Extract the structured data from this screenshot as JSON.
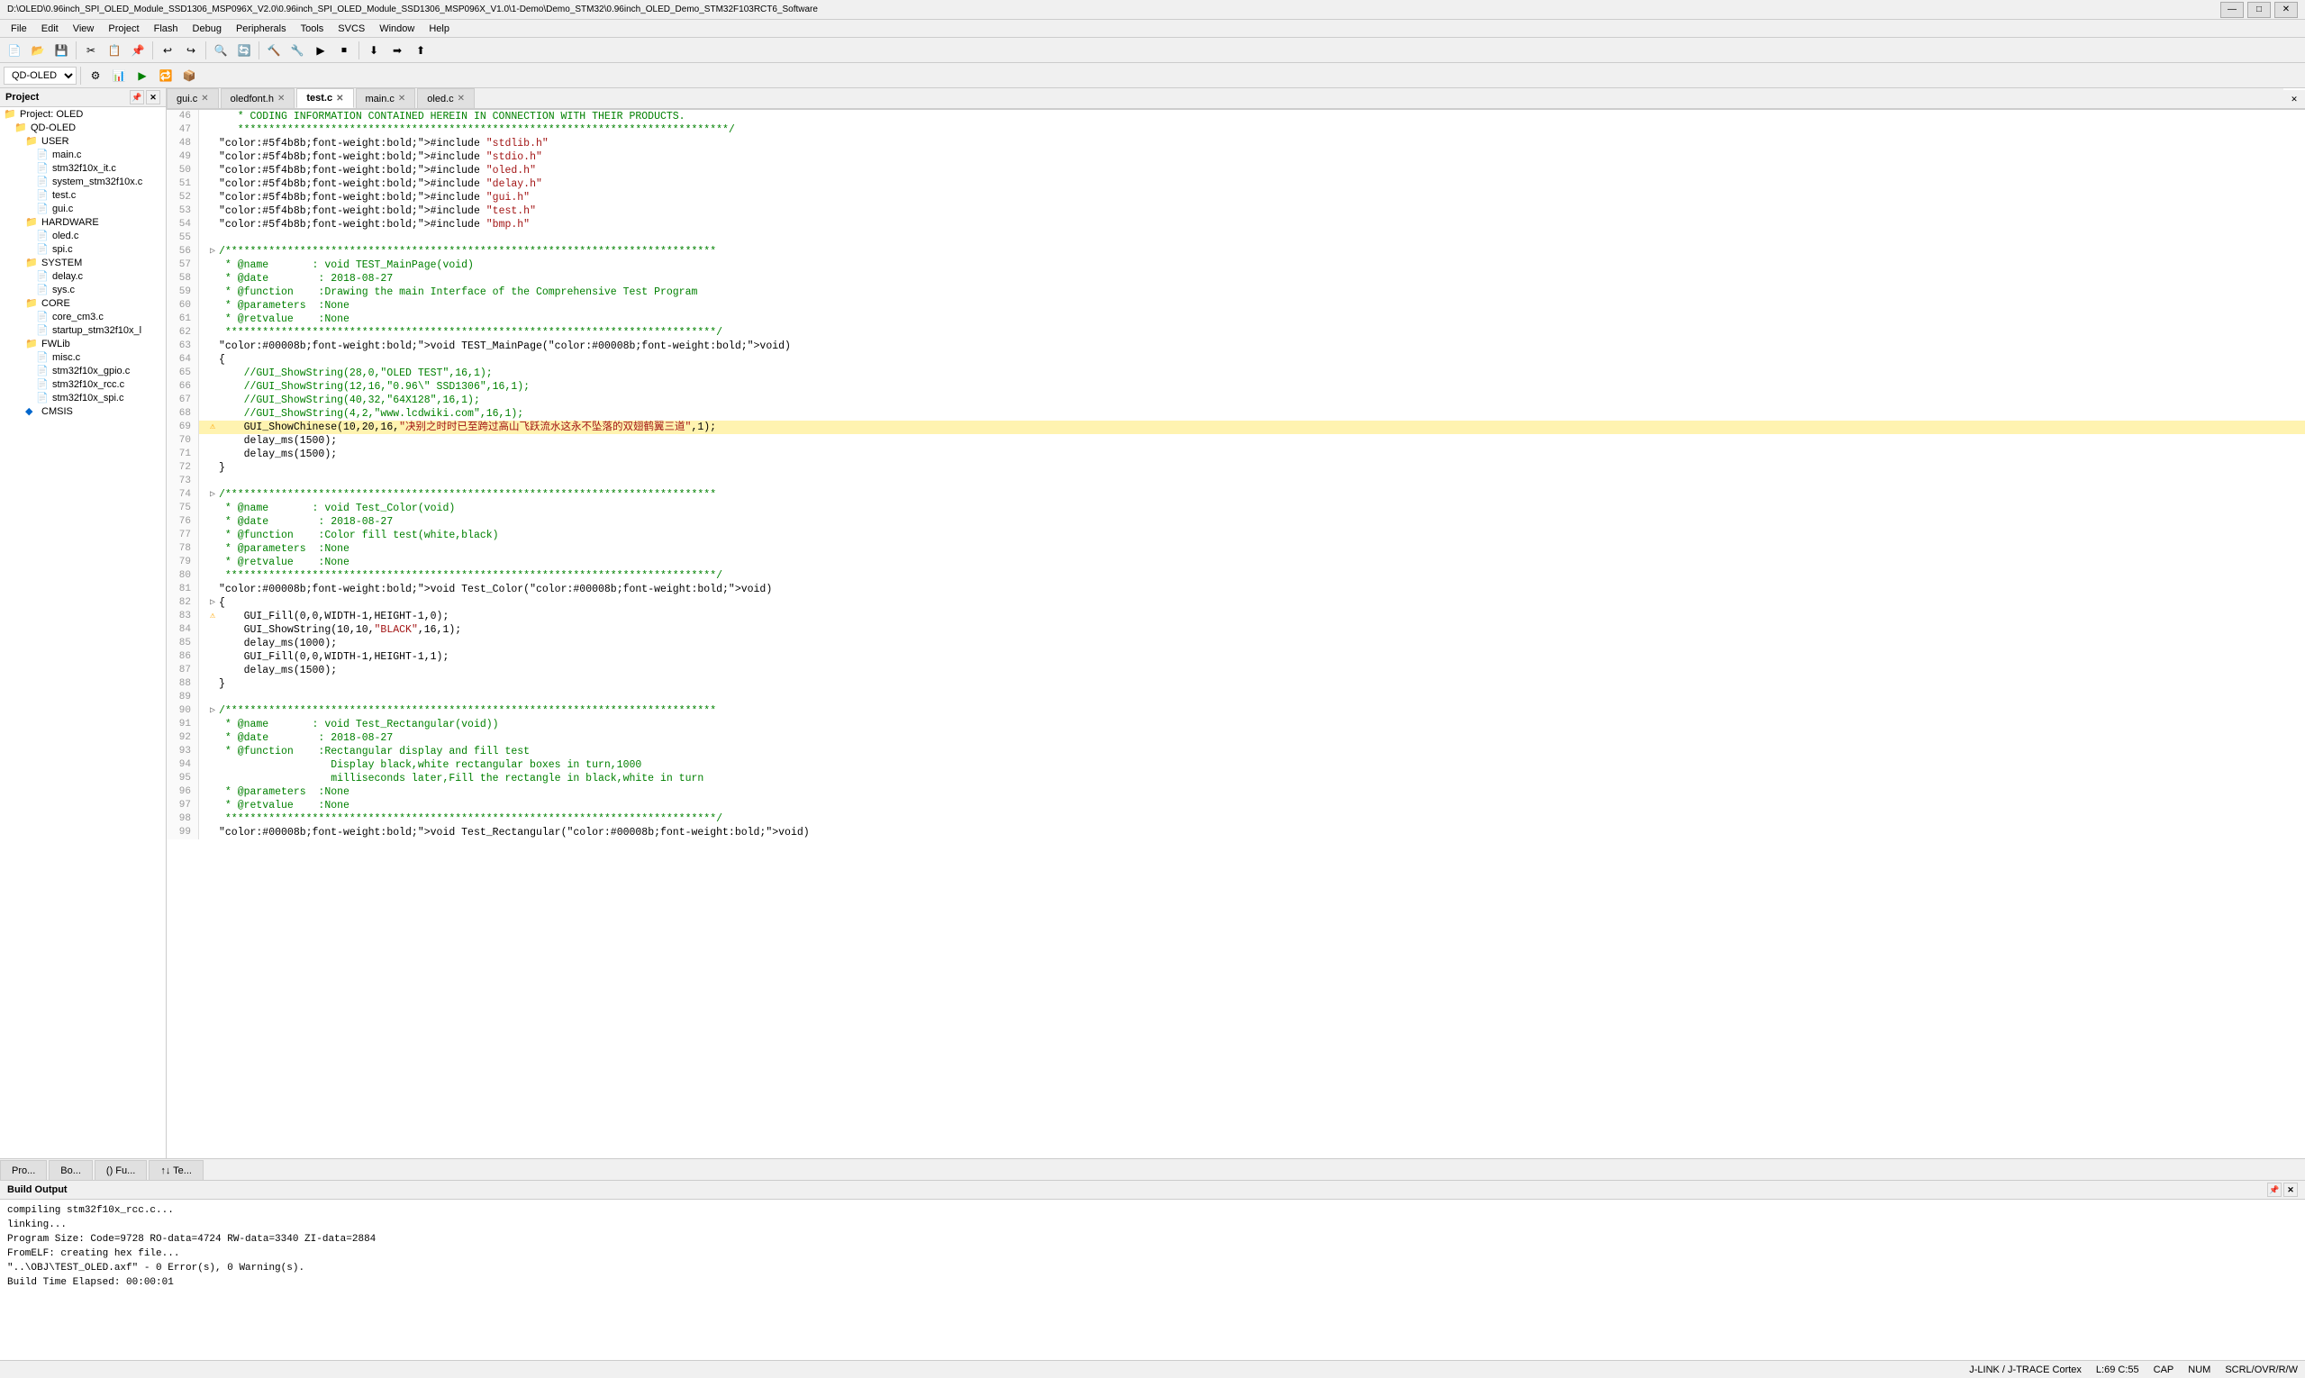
{
  "titleBar": {
    "text": "D:\\OLED\\0.96inch_SPI_OLED_Module_SSD1306_MSP096X_V2.0\\0.96inch_SPI_OLED_Module_SSD1306_MSP096X_V1.0\\1-Demo\\Demo_STM32\\0.96inch_OLED_Demo_STM32F103RCT6_Software",
    "minBtn": "—",
    "maxBtn": "□",
    "closeBtn": "✕"
  },
  "menuBar": {
    "items": [
      "File",
      "Edit",
      "View",
      "Project",
      "Flash",
      "Debug",
      "Peripherals",
      "Tools",
      "SVCS",
      "Window",
      "Help"
    ]
  },
  "toolbar1": {
    "buttons": [
      "📂",
      "💾",
      "✕",
      "📋",
      "📋",
      "↩",
      "↪",
      "🔍",
      "🔍",
      "🔧",
      "🔧",
      "🔧",
      "🔧",
      "🔧"
    ]
  },
  "toolbar2": {
    "select": "QD-OLED",
    "buttons": []
  },
  "sidebar": {
    "title": "Project",
    "projectRoot": "Project: OLED",
    "tree": [
      {
        "id": "oled",
        "label": "Project: OLED",
        "level": 0,
        "icon": "📁",
        "expanded": true
      },
      {
        "id": "qd-oled",
        "label": "QD-OLED",
        "level": 1,
        "icon": "📁",
        "expanded": true
      },
      {
        "id": "user",
        "label": "USER",
        "level": 2,
        "icon": "📁",
        "expanded": true
      },
      {
        "id": "main-c",
        "label": "main.c",
        "level": 3,
        "icon": "📄"
      },
      {
        "id": "stm32f10x_it",
        "label": "stm32f10x_it.c",
        "level": 3,
        "icon": "📄"
      },
      {
        "id": "system_stm32f10x",
        "label": "system_stm32f10x.c",
        "level": 3,
        "icon": "📄"
      },
      {
        "id": "test-c",
        "label": "test.c",
        "level": 3,
        "icon": "📄"
      },
      {
        "id": "gui-c",
        "label": "gui.c",
        "level": 3,
        "icon": "📄"
      },
      {
        "id": "hardware",
        "label": "HARDWARE",
        "level": 2,
        "icon": "📁",
        "expanded": true
      },
      {
        "id": "oled-c",
        "label": "oled.c",
        "level": 3,
        "icon": "📄"
      },
      {
        "id": "spi-c",
        "label": "spi.c",
        "level": 3,
        "icon": "📄"
      },
      {
        "id": "system",
        "label": "SYSTEM",
        "level": 2,
        "icon": "📁",
        "expanded": true
      },
      {
        "id": "delay-c",
        "label": "delay.c",
        "level": 3,
        "icon": "📄"
      },
      {
        "id": "sys-c",
        "label": "sys.c",
        "level": 3,
        "icon": "📄"
      },
      {
        "id": "core",
        "label": "CORE",
        "level": 2,
        "icon": "📁",
        "expanded": true
      },
      {
        "id": "core-cm3",
        "label": "core_cm3.c",
        "level": 3,
        "icon": "📄"
      },
      {
        "id": "startup",
        "label": "startup_stm32f10x_l",
        "level": 3,
        "icon": "📄"
      },
      {
        "id": "fwlib",
        "label": "FWLib",
        "level": 2,
        "icon": "📁",
        "expanded": true
      },
      {
        "id": "misc",
        "label": "misc.c",
        "level": 3,
        "icon": "📄"
      },
      {
        "id": "stm32f10x-gpio",
        "label": "stm32f10x_gpio.c",
        "level": 3,
        "icon": "📄"
      },
      {
        "id": "stm32f10x-rcc",
        "label": "stm32f10x_rcc.c",
        "level": 3,
        "icon": "📄"
      },
      {
        "id": "stm32f10x-spi",
        "label": "stm32f10x_spi.c",
        "level": 3,
        "icon": "📄"
      },
      {
        "id": "cmsis",
        "label": "CMSIS",
        "level": 2,
        "icon": "💠"
      }
    ]
  },
  "tabs": [
    {
      "id": "gui-c",
      "label": "gui.c",
      "active": false,
      "icon": "📄"
    },
    {
      "id": "oledfont-h",
      "label": "oledfont.h",
      "active": false,
      "icon": "📄"
    },
    {
      "id": "test-c",
      "label": "test.c",
      "active": true,
      "icon": "📄"
    },
    {
      "id": "main-c",
      "label": "main.c",
      "active": false,
      "icon": "📄"
    },
    {
      "id": "oled-c",
      "label": "oled.c",
      "active": false,
      "icon": "📄"
    }
  ],
  "codeLines": [
    {
      "num": 46,
      "content": "   * CODING INFORMATION CONTAINED HEREIN IN CONNECTION WITH THEIR PRODUCTS.",
      "type": "comment"
    },
    {
      "num": 47,
      "content": "   *******************************************************************************/",
      "type": "comment"
    },
    {
      "num": 48,
      "content": "#include \"stdlib.h\"",
      "type": "include"
    },
    {
      "num": 49,
      "content": "#include \"stdio.h\"",
      "type": "include"
    },
    {
      "num": 50,
      "content": "#include \"oled.h\"",
      "type": "include"
    },
    {
      "num": 51,
      "content": "#include \"delay.h\"",
      "type": "include"
    },
    {
      "num": 52,
      "content": "#include \"gui.h\"",
      "type": "include"
    },
    {
      "num": 53,
      "content": "#include \"test.h\"",
      "type": "include"
    },
    {
      "num": 54,
      "content": "#include \"bmp.h\"",
      "type": "include"
    },
    {
      "num": 55,
      "content": "",
      "type": "blank"
    },
    {
      "num": 56,
      "content": "/*******************************************************************************",
      "type": "comment",
      "indicator": "▷"
    },
    {
      "num": 57,
      "content": " * @name       : void TEST_MainPage(void)",
      "type": "comment"
    },
    {
      "num": 58,
      "content": " * @date        : 2018-08-27",
      "type": "comment"
    },
    {
      "num": 59,
      "content": " * @function    :Drawing the main Interface of the Comprehensive Test Program",
      "type": "comment"
    },
    {
      "num": 60,
      "content": " * @parameters  :None",
      "type": "comment"
    },
    {
      "num": 61,
      "content": " * @retvalue    :None",
      "type": "comment"
    },
    {
      "num": 62,
      "content": " *******************************************************************************/",
      "type": "comment"
    },
    {
      "num": 63,
      "content": "void TEST_MainPage(void)",
      "type": "code"
    },
    {
      "num": 64,
      "content": "{",
      "type": "code"
    },
    {
      "num": 65,
      "content": "    //GUI_ShowString(28,0,\"OLED TEST\",16,1);",
      "type": "commented-code"
    },
    {
      "num": 66,
      "content": "    //GUI_ShowString(12,16,\"0.96\\\" SSD1306\",16,1);",
      "type": "commented-code"
    },
    {
      "num": 67,
      "content": "    //GUI_ShowString(40,32,\"64X128\",16,1);",
      "type": "commented-code"
    },
    {
      "num": 68,
      "content": "    //GUI_ShowString(4,2,\"www.lcdwiki.com\",16,1);",
      "type": "commented-code"
    },
    {
      "num": 69,
      "content": "    GUI_ShowChinese(10,20,16,\"决别之时时已至跨过高山飞跃流水这永不坠落的双翅鹤翼三道\",1);",
      "type": "code",
      "indicator": "⚠",
      "highlight": true
    },
    {
      "num": 70,
      "content": "    delay_ms(1500);",
      "type": "code"
    },
    {
      "num": 71,
      "content": "    delay_ms(1500);",
      "type": "code"
    },
    {
      "num": 72,
      "content": "}",
      "type": "code"
    },
    {
      "num": 73,
      "content": "",
      "type": "blank"
    },
    {
      "num": 74,
      "content": "/*******************************************************************************",
      "type": "comment",
      "indicator": "▷"
    },
    {
      "num": 75,
      "content": " * @name       : void Test_Color(void)",
      "type": "comment"
    },
    {
      "num": 76,
      "content": " * @date        : 2018-08-27",
      "type": "comment"
    },
    {
      "num": 77,
      "content": " * @function    :Color fill test(white,black)",
      "type": "comment"
    },
    {
      "num": 78,
      "content": " * @parameters  :None",
      "type": "comment"
    },
    {
      "num": 79,
      "content": " * @retvalue    :None",
      "type": "comment"
    },
    {
      "num": 80,
      "content": " *******************************************************************************/",
      "type": "comment"
    },
    {
      "num": 81,
      "content": "void Test_Color(void)",
      "type": "code"
    },
    {
      "num": 82,
      "content": "{",
      "type": "code",
      "indicator": "▷"
    },
    {
      "num": 83,
      "content": "    GUI_Fill(0,0,WIDTH-1,HEIGHT-1,0);",
      "type": "code",
      "indicator": "⚠"
    },
    {
      "num": 84,
      "content": "    GUI_ShowString(10,10,\"BLACK\",16,1);",
      "type": "code"
    },
    {
      "num": 85,
      "content": "    delay_ms(1000);",
      "type": "code"
    },
    {
      "num": 86,
      "content": "    GUI_Fill(0,0,WIDTH-1,HEIGHT-1,1);",
      "type": "code"
    },
    {
      "num": 87,
      "content": "    delay_ms(1500);",
      "type": "code"
    },
    {
      "num": 88,
      "content": "}",
      "type": "code"
    },
    {
      "num": 89,
      "content": "",
      "type": "blank"
    },
    {
      "num": 90,
      "content": "/*******************************************************************************",
      "type": "comment",
      "indicator": "▷"
    },
    {
      "num": 91,
      "content": " * @name       : void Test_Rectangular(void))",
      "type": "comment"
    },
    {
      "num": 92,
      "content": " * @date        : 2018-08-27",
      "type": "comment"
    },
    {
      "num": 93,
      "content": " * @function    :Rectangular display and fill test",
      "type": "comment"
    },
    {
      "num": 94,
      "content": "                  Display black,white rectangular boxes in turn,1000",
      "type": "comment"
    },
    {
      "num": 95,
      "content": "                  milliseconds later,Fill the rectangle in black,white in turn",
      "type": "comment"
    },
    {
      "num": 96,
      "content": " * @parameters  :None",
      "type": "comment"
    },
    {
      "num": 97,
      "content": " * @retvalue    :None",
      "type": "comment"
    },
    {
      "num": 98,
      "content": " *******************************************************************************/",
      "type": "comment"
    },
    {
      "num": 99,
      "content": "void Test_Rectangular(void)",
      "type": "code"
    }
  ],
  "bottomTabs": [
    {
      "id": "project",
      "label": "Pro...",
      "active": false
    },
    {
      "id": "books",
      "label": "Bo...",
      "active": false
    },
    {
      "id": "functions",
      "label": "() Fu...",
      "active": false
    },
    {
      "id": "templates",
      "label": "↑↓ Te...",
      "active": false
    }
  ],
  "buildOutput": {
    "title": "Build Output",
    "lines": [
      "compiling stm32f10x_rcc.c...",
      "linking...",
      "Program Size: Code=9728  RO-data=4724  RW-data=3340  ZI-data=2884",
      "FromELF: creating hex file...",
      "\"..\\OBJ\\TEST_OLED.axf\" - 0 Error(s), 0 Warning(s).",
      "Build Time Elapsed:  00:00:01"
    ]
  },
  "statusBar": {
    "debugger": "J-LINK / J-TRACE Cortex",
    "position": "L:69 C:55",
    "capsLock": "CAP",
    "numLock": "NUM",
    "scrollLock": "SCRL/OVR/R/W"
  },
  "icons": {
    "folder-open": "📂",
    "folder": "📁",
    "file": "📄",
    "warning": "⚠",
    "error": "❌",
    "expand": "▷",
    "collapse": "▽",
    "diamond": "◆"
  }
}
